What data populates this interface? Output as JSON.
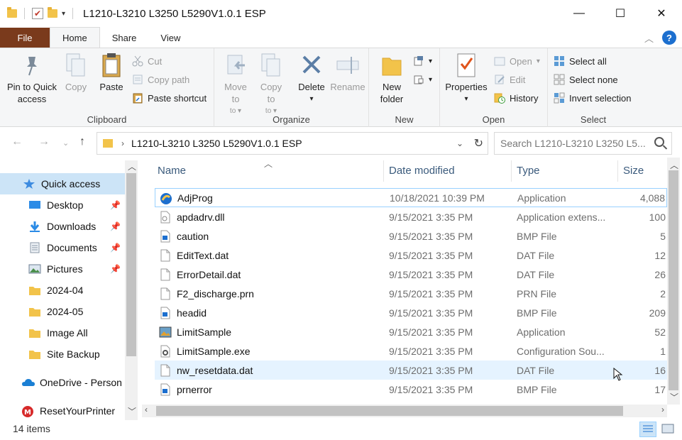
{
  "window": {
    "title": "L1210-L3210 L3250 L5290V1.0.1 ESP",
    "minimize": "—",
    "maximize": "☐",
    "close": "✕"
  },
  "tabs": [
    {
      "label": "File"
    },
    {
      "label": "Home"
    },
    {
      "label": "Share"
    },
    {
      "label": "View"
    }
  ],
  "ribbon": {
    "clipboard": {
      "label": "Clipboard",
      "pin": "Pin to Quick access",
      "copy": "Copy",
      "paste": "Paste",
      "cut": "Cut",
      "copy_path": "Copy path",
      "paste_shortcut": "Paste shortcut"
    },
    "organize": {
      "label": "Organize",
      "move_to": "Move to",
      "copy_to": "Copy to",
      "delete": "Delete",
      "rename": "Rename"
    },
    "new": {
      "label": "New",
      "new_folder": "New folder"
    },
    "open": {
      "label": "Open",
      "properties": "Properties",
      "open": "Open",
      "edit": "Edit",
      "history": "History"
    },
    "select": {
      "label": "Select",
      "select_all": "Select all",
      "select_none": "Select none",
      "invert": "Invert selection"
    }
  },
  "address": {
    "path": "L1210-L3210 L3250 L5290V1.0.1 ESP",
    "search_placeholder": "Search L1210-L3210 L3250 L5..."
  },
  "nav": {
    "items": [
      {
        "label": "Quick access",
        "icon": "star-icon"
      },
      {
        "label": "Desktop",
        "icon": "desktop-icon"
      },
      {
        "label": "Downloads",
        "icon": "download-icon"
      },
      {
        "label": "Documents",
        "icon": "documents-icon"
      },
      {
        "label": "Pictures",
        "icon": "pictures-icon"
      },
      {
        "label": "2024-04",
        "icon": "folder-icon"
      },
      {
        "label": "2024-05",
        "icon": "folder-icon"
      },
      {
        "label": "Image All",
        "icon": "folder-icon"
      },
      {
        "label": "Site Backup",
        "icon": "folder-icon"
      },
      {
        "label": "OneDrive - Person",
        "icon": "cloud-icon"
      },
      {
        "label": "ResetYourPrinter",
        "icon": "app-icon"
      }
    ]
  },
  "columns": {
    "name": "Name",
    "date": "Date modified",
    "type": "Type",
    "size": "Size"
  },
  "files": [
    {
      "name": "AdjProg",
      "date": "10/18/2021 10:39 PM",
      "type": "Application",
      "size": "4,088",
      "icon": "adjprog-icon"
    },
    {
      "name": "apdadrv.dll",
      "date": "9/15/2021 3:35 PM",
      "type": "Application extens...",
      "size": "100",
      "icon": "dll-icon"
    },
    {
      "name": "caution",
      "date": "9/15/2021 3:35 PM",
      "type": "BMP File",
      "size": "5",
      "icon": "bmp-icon"
    },
    {
      "name": "EditText.dat",
      "date": "9/15/2021 3:35 PM",
      "type": "DAT File",
      "size": "12",
      "icon": "file-icon"
    },
    {
      "name": "ErrorDetail.dat",
      "date": "9/15/2021 3:35 PM",
      "type": "DAT File",
      "size": "26",
      "icon": "file-icon"
    },
    {
      "name": "F2_discharge.prn",
      "date": "9/15/2021 3:35 PM",
      "type": "PRN File",
      "size": "2",
      "icon": "file-icon"
    },
    {
      "name": "headid",
      "date": "9/15/2021 3:35 PM",
      "type": "BMP File",
      "size": "209",
      "icon": "bmp-icon"
    },
    {
      "name": "LimitSample",
      "date": "9/15/2021 3:35 PM",
      "type": "Application",
      "size": "52",
      "icon": "image-app-icon"
    },
    {
      "name": "LimitSample.exe",
      "date": "9/15/2021 3:35 PM",
      "type": "Configuration Sou...",
      "size": "1",
      "icon": "config-icon"
    },
    {
      "name": "nw_resetdata.dat",
      "date": "9/15/2021 3:35 PM",
      "type": "DAT File",
      "size": "16",
      "icon": "file-icon"
    },
    {
      "name": "prnerror",
      "date": "9/15/2021 3:35 PM",
      "type": "BMP File",
      "size": "17",
      "icon": "bmp-icon"
    }
  ],
  "status": {
    "count": "14 items"
  }
}
